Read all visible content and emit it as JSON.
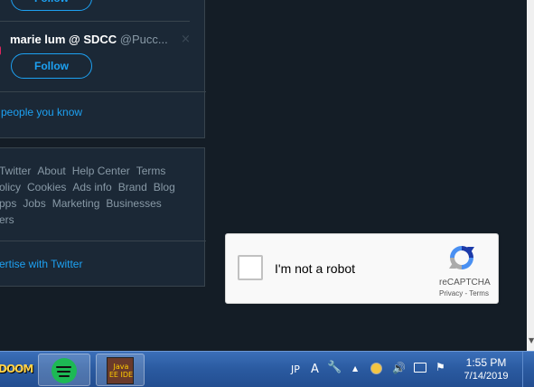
{
  "who_to_follow": {
    "top_follow_label": "Follow",
    "user": {
      "name": "marie lum @ SDCC",
      "handle": "@Pucc...",
      "follow_label": "Follow",
      "dismiss_glyph": "×"
    },
    "find_people_label": "people you know"
  },
  "footer_links": {
    "rows": [
      [
        "Twitter",
        "About",
        "Help Center",
        "Terms"
      ],
      [
        "olicy",
        "Cookies",
        "Ads info",
        "Brand",
        "Blog"
      ],
      [
        "pps",
        "Jobs",
        "Marketing",
        "Businesses"
      ],
      [
        "ers"
      ]
    ],
    "advertise_label": "ertise with Twitter"
  },
  "recaptcha": {
    "label": "I'm not a robot",
    "brand": "reCAPTCHA",
    "terms": "Privacy - Terms",
    "checked": false
  },
  "taskbar": {
    "apps": [
      {
        "name": "doom",
        "label": "DOOM"
      },
      {
        "name": "spotify",
        "label": ""
      },
      {
        "name": "java-ee-ide",
        "label": "Java EE IDE"
      }
    ],
    "tray": {
      "language": "JP",
      "ime": "A"
    },
    "clock": {
      "time": "1:55 PM",
      "date": "7/14/2019"
    }
  },
  "colors": {
    "background": "#141d26",
    "panel": "#1b2836",
    "accent": "#1da1f2",
    "muted_text": "#8899a6",
    "taskbar": "#2a5aa0"
  }
}
